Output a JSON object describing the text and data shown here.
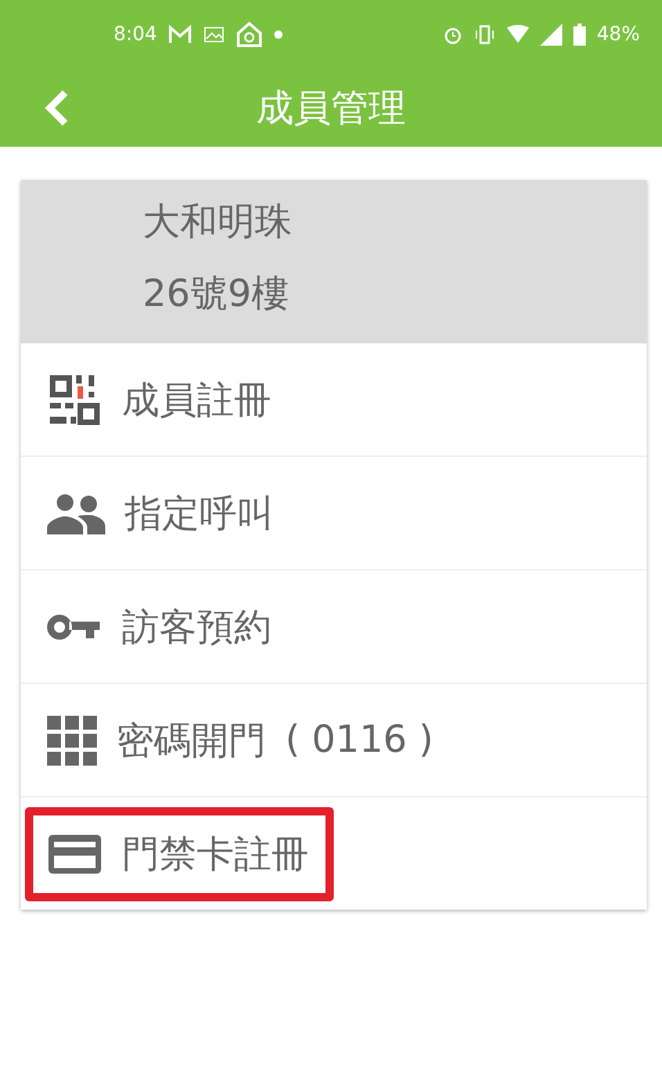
{
  "status_bar": {
    "time": "8:04",
    "battery": "48%"
  },
  "toolbar": {
    "title": "成員管理"
  },
  "unit": {
    "name": "大和明珠",
    "address": "26號9樓"
  },
  "menu": [
    {
      "kind": "qr",
      "label": "成員註冊",
      "highlighted": false
    },
    {
      "kind": "people",
      "label": "指定呼叫",
      "highlighted": false
    },
    {
      "kind": "key",
      "label": "訪客預約",
      "highlighted": false
    },
    {
      "kind": "keypad",
      "label": "密碼開門",
      "code": "( 0116 )",
      "highlighted": false
    },
    {
      "kind": "card",
      "label": "門禁卡註冊",
      "highlighted": true
    }
  ]
}
